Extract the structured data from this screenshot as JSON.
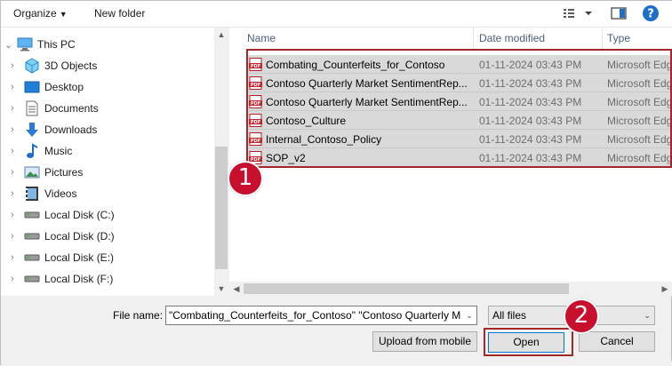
{
  "toolbar": {
    "organize_label": "Organize",
    "new_folder_label": "New folder",
    "view_icon": "view-options-icon",
    "preview_icon": "preview-pane-icon",
    "help_icon": "help-icon",
    "help_glyph": "?"
  },
  "nav": {
    "items": [
      {
        "label": "This PC",
        "icon": "computer-icon",
        "expanded": true
      },
      {
        "label": "3D Objects",
        "icon": "3d-objects-icon"
      },
      {
        "label": "Desktop",
        "icon": "desktop-icon"
      },
      {
        "label": "Documents",
        "icon": "documents-icon"
      },
      {
        "label": "Downloads",
        "icon": "downloads-icon"
      },
      {
        "label": "Music",
        "icon": "music-icon"
      },
      {
        "label": "Pictures",
        "icon": "pictures-icon"
      },
      {
        "label": "Videos",
        "icon": "videos-icon"
      },
      {
        "label": "Local Disk (C:)",
        "icon": "drive-icon"
      },
      {
        "label": "Local Disk (D:)",
        "icon": "drive-icon"
      },
      {
        "label": "Local Disk (E:)",
        "icon": "drive-icon"
      },
      {
        "label": "Local Disk (F:)",
        "icon": "drive-icon"
      }
    ]
  },
  "files": {
    "columns": {
      "name": "Name",
      "date": "Date modified",
      "type": "Type"
    },
    "rows": [
      {
        "name": "Combating_Counterfeits_for_Contoso",
        "date": "01-11-2024 03:43 PM",
        "type": "Microsoft Edg"
      },
      {
        "name": "Contoso Quarterly Market SentimentRep...",
        "date": "01-11-2024 03:43 PM",
        "type": "Microsoft Edg"
      },
      {
        "name": "Contoso Quarterly Market SentimentRep...",
        "date": "01-11-2024 03:43 PM",
        "type": "Microsoft Edg"
      },
      {
        "name": "Contoso_Culture",
        "date": "01-11-2024 03:43 PM",
        "type": "Microsoft Edg"
      },
      {
        "name": "Internal_Contoso_Policy",
        "date": "01-11-2024 03:43 PM",
        "type": "Microsoft Edg"
      },
      {
        "name": "SOP_v2",
        "date": "01-11-2024 03:43 PM",
        "type": "Microsoft Edg"
      }
    ]
  },
  "footer": {
    "file_name_label": "File name:",
    "file_name_value": "\"Combating_Counterfeits_for_Contoso\" \"Contoso Quarterly M",
    "file_type_value": "All files",
    "upload_label": "Upload from mobile",
    "open_label": "Open",
    "cancel_label": "Cancel"
  },
  "annotations": {
    "step1": "1",
    "step2": "2",
    "color": "#c8102e"
  }
}
